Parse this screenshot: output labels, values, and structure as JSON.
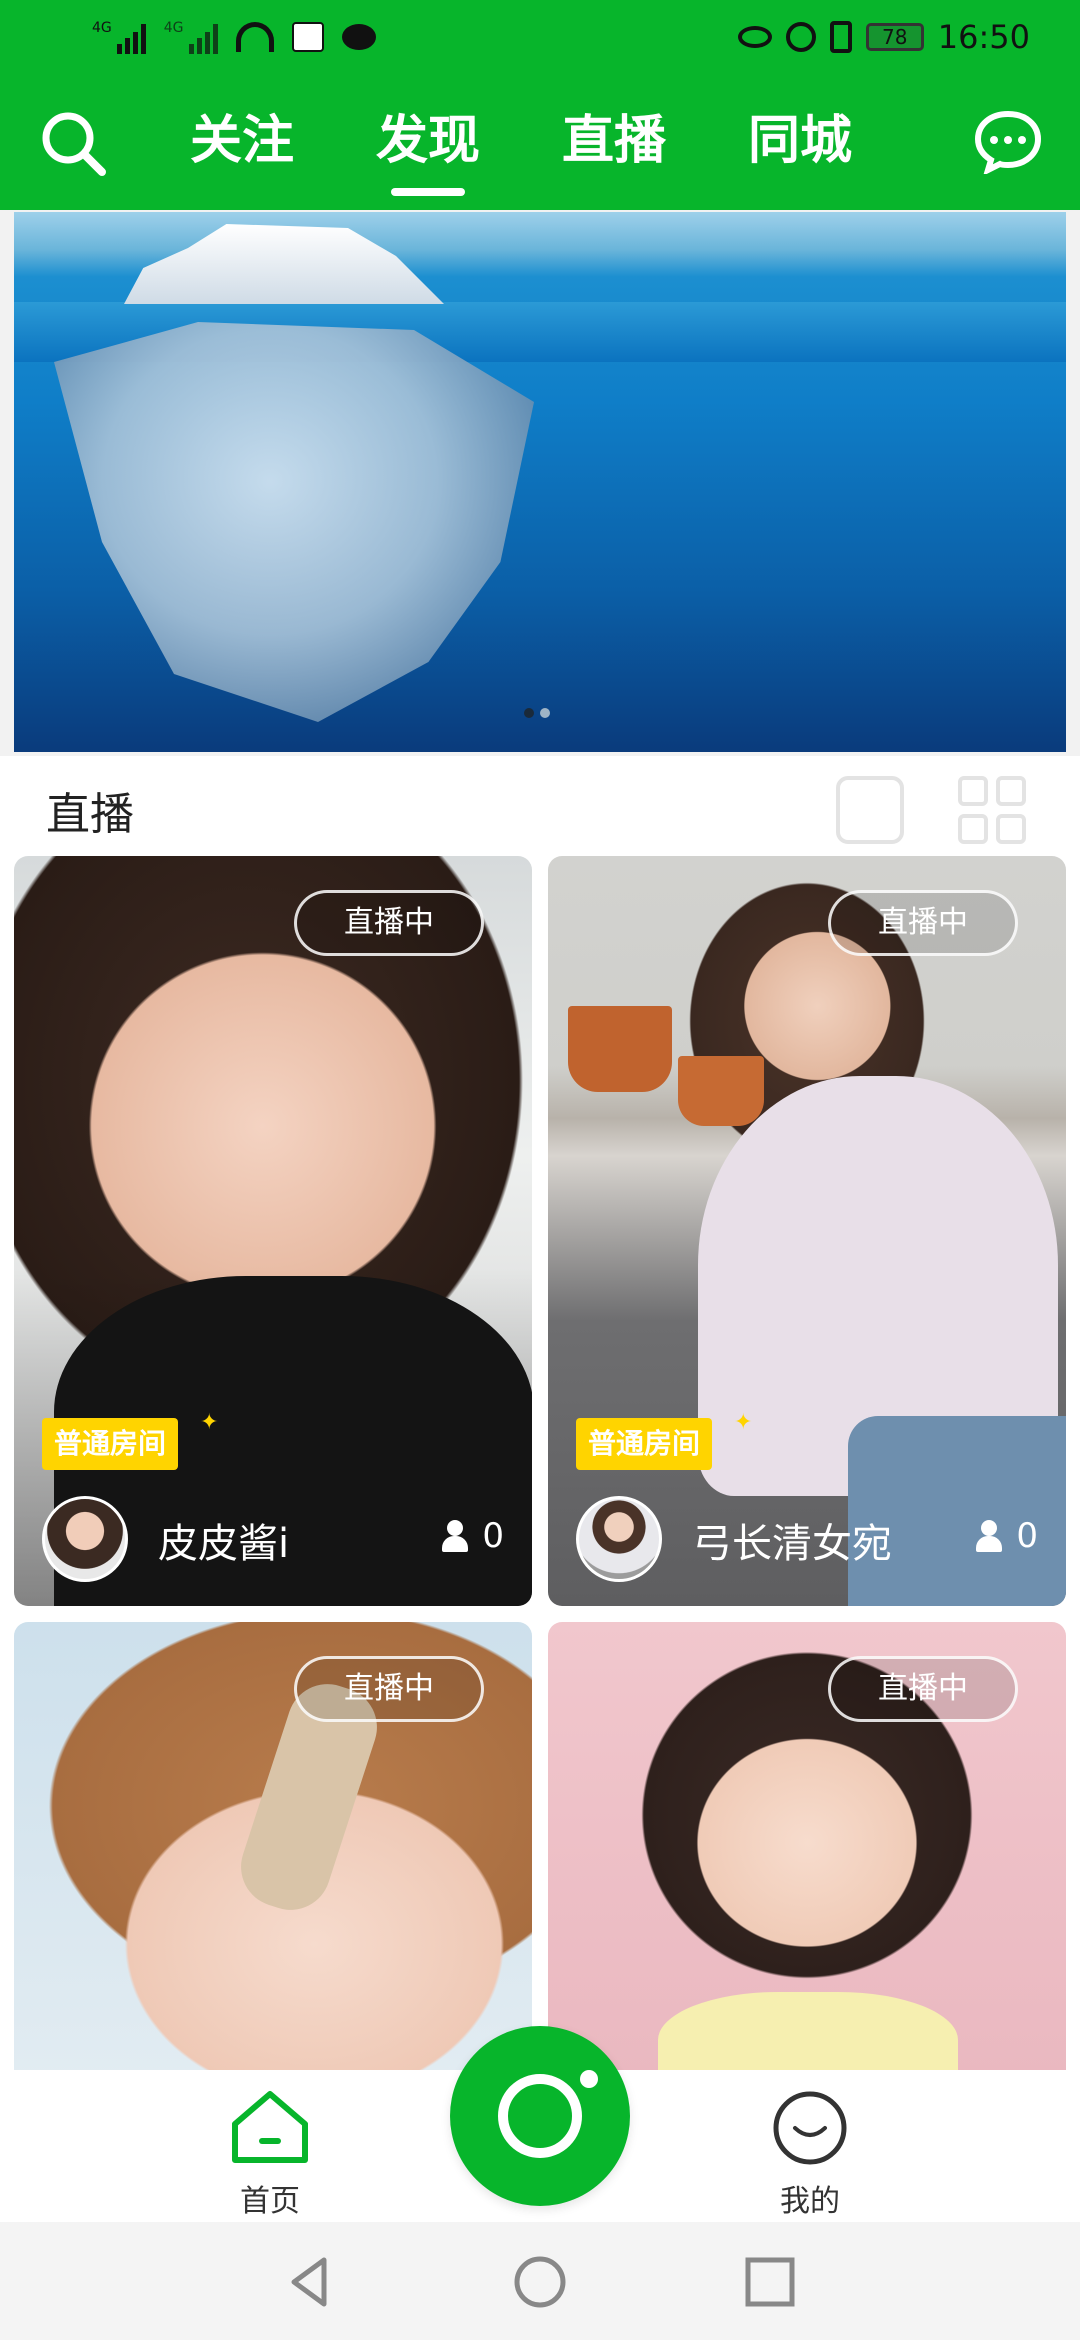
{
  "status_bar": {
    "signal1_label": "4G",
    "signal2_label": "4G",
    "battery": "78",
    "time": "16:50"
  },
  "header": {
    "tabs": [
      {
        "label": "关注"
      },
      {
        "label": "发现"
      },
      {
        "label": "直播"
      },
      {
        "label": "同城"
      }
    ],
    "active_tab": "发现",
    "accent_color": "#07b52b"
  },
  "banner": {
    "dots": 2,
    "active_dot": 0
  },
  "section": {
    "title": "直播"
  },
  "streams": [
    {
      "badge": "直播中",
      "room_tag": "普通房间",
      "name": "皮皮酱i",
      "viewers": "0"
    },
    {
      "badge": "直播中",
      "room_tag": "普通房间",
      "name": "弓长清女宛",
      "viewers": "0"
    },
    {
      "badge": "直播中"
    },
    {
      "badge": "直播中"
    }
  ],
  "bottom_nav": {
    "home_label": "首页",
    "me_label": "我的"
  }
}
